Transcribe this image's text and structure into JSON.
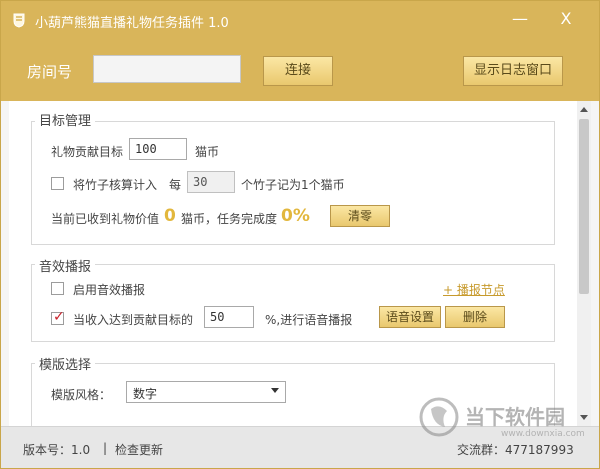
{
  "window": {
    "title": "小葫芦熊猫直播礼物任务插件 1.0",
    "minimize": "—",
    "close": "X"
  },
  "topbar": {
    "room_label": "房间号",
    "room_value": "",
    "connect_label": "连接",
    "log_label": "显示日志窗口"
  },
  "target": {
    "group_title": "目标管理",
    "gift_label": "礼物贡献目标",
    "gift_value": "100",
    "gift_unit": "猫币",
    "bamboo_label": "将竹子核算计入",
    "bamboo_checked": false,
    "every_label": "每",
    "bamboo_value": "30",
    "bamboo_suffix": "个竹子记为1个猫币",
    "received_label": "当前已收到礼物价值",
    "received_value": "0",
    "received_unit_label": "猫币，任务完成度",
    "progress_value": "0%",
    "reset_label": "清零"
  },
  "audio": {
    "group_title": "音效播报",
    "enable_label": "启用音效播报",
    "enable_checked": false,
    "node_link": "+ 播报节点",
    "voice_checked": true,
    "voice_check_mark": "✓",
    "reach_label": "当收入达到贡献目标的",
    "reach_value": "50",
    "reach_suffix": "%,进行语音播报",
    "voice_settings_label": "语音设置",
    "delete_label": "删除"
  },
  "template": {
    "group_title": "模版选择",
    "style_label": "模版风格：",
    "style_value": "数字"
  },
  "status": {
    "version": "版本号：1.0",
    "separator": "|",
    "check_update": "检查更新",
    "qq_group": "交流群：477187993"
  },
  "watermark": {
    "text": "当下软件园",
    "url": "www.downxia.com"
  },
  "colors": {
    "accent": "#d9b55a",
    "button": "#e9c86e",
    "progress": "#e2b73d",
    "check_mark": "#c8202a"
  }
}
